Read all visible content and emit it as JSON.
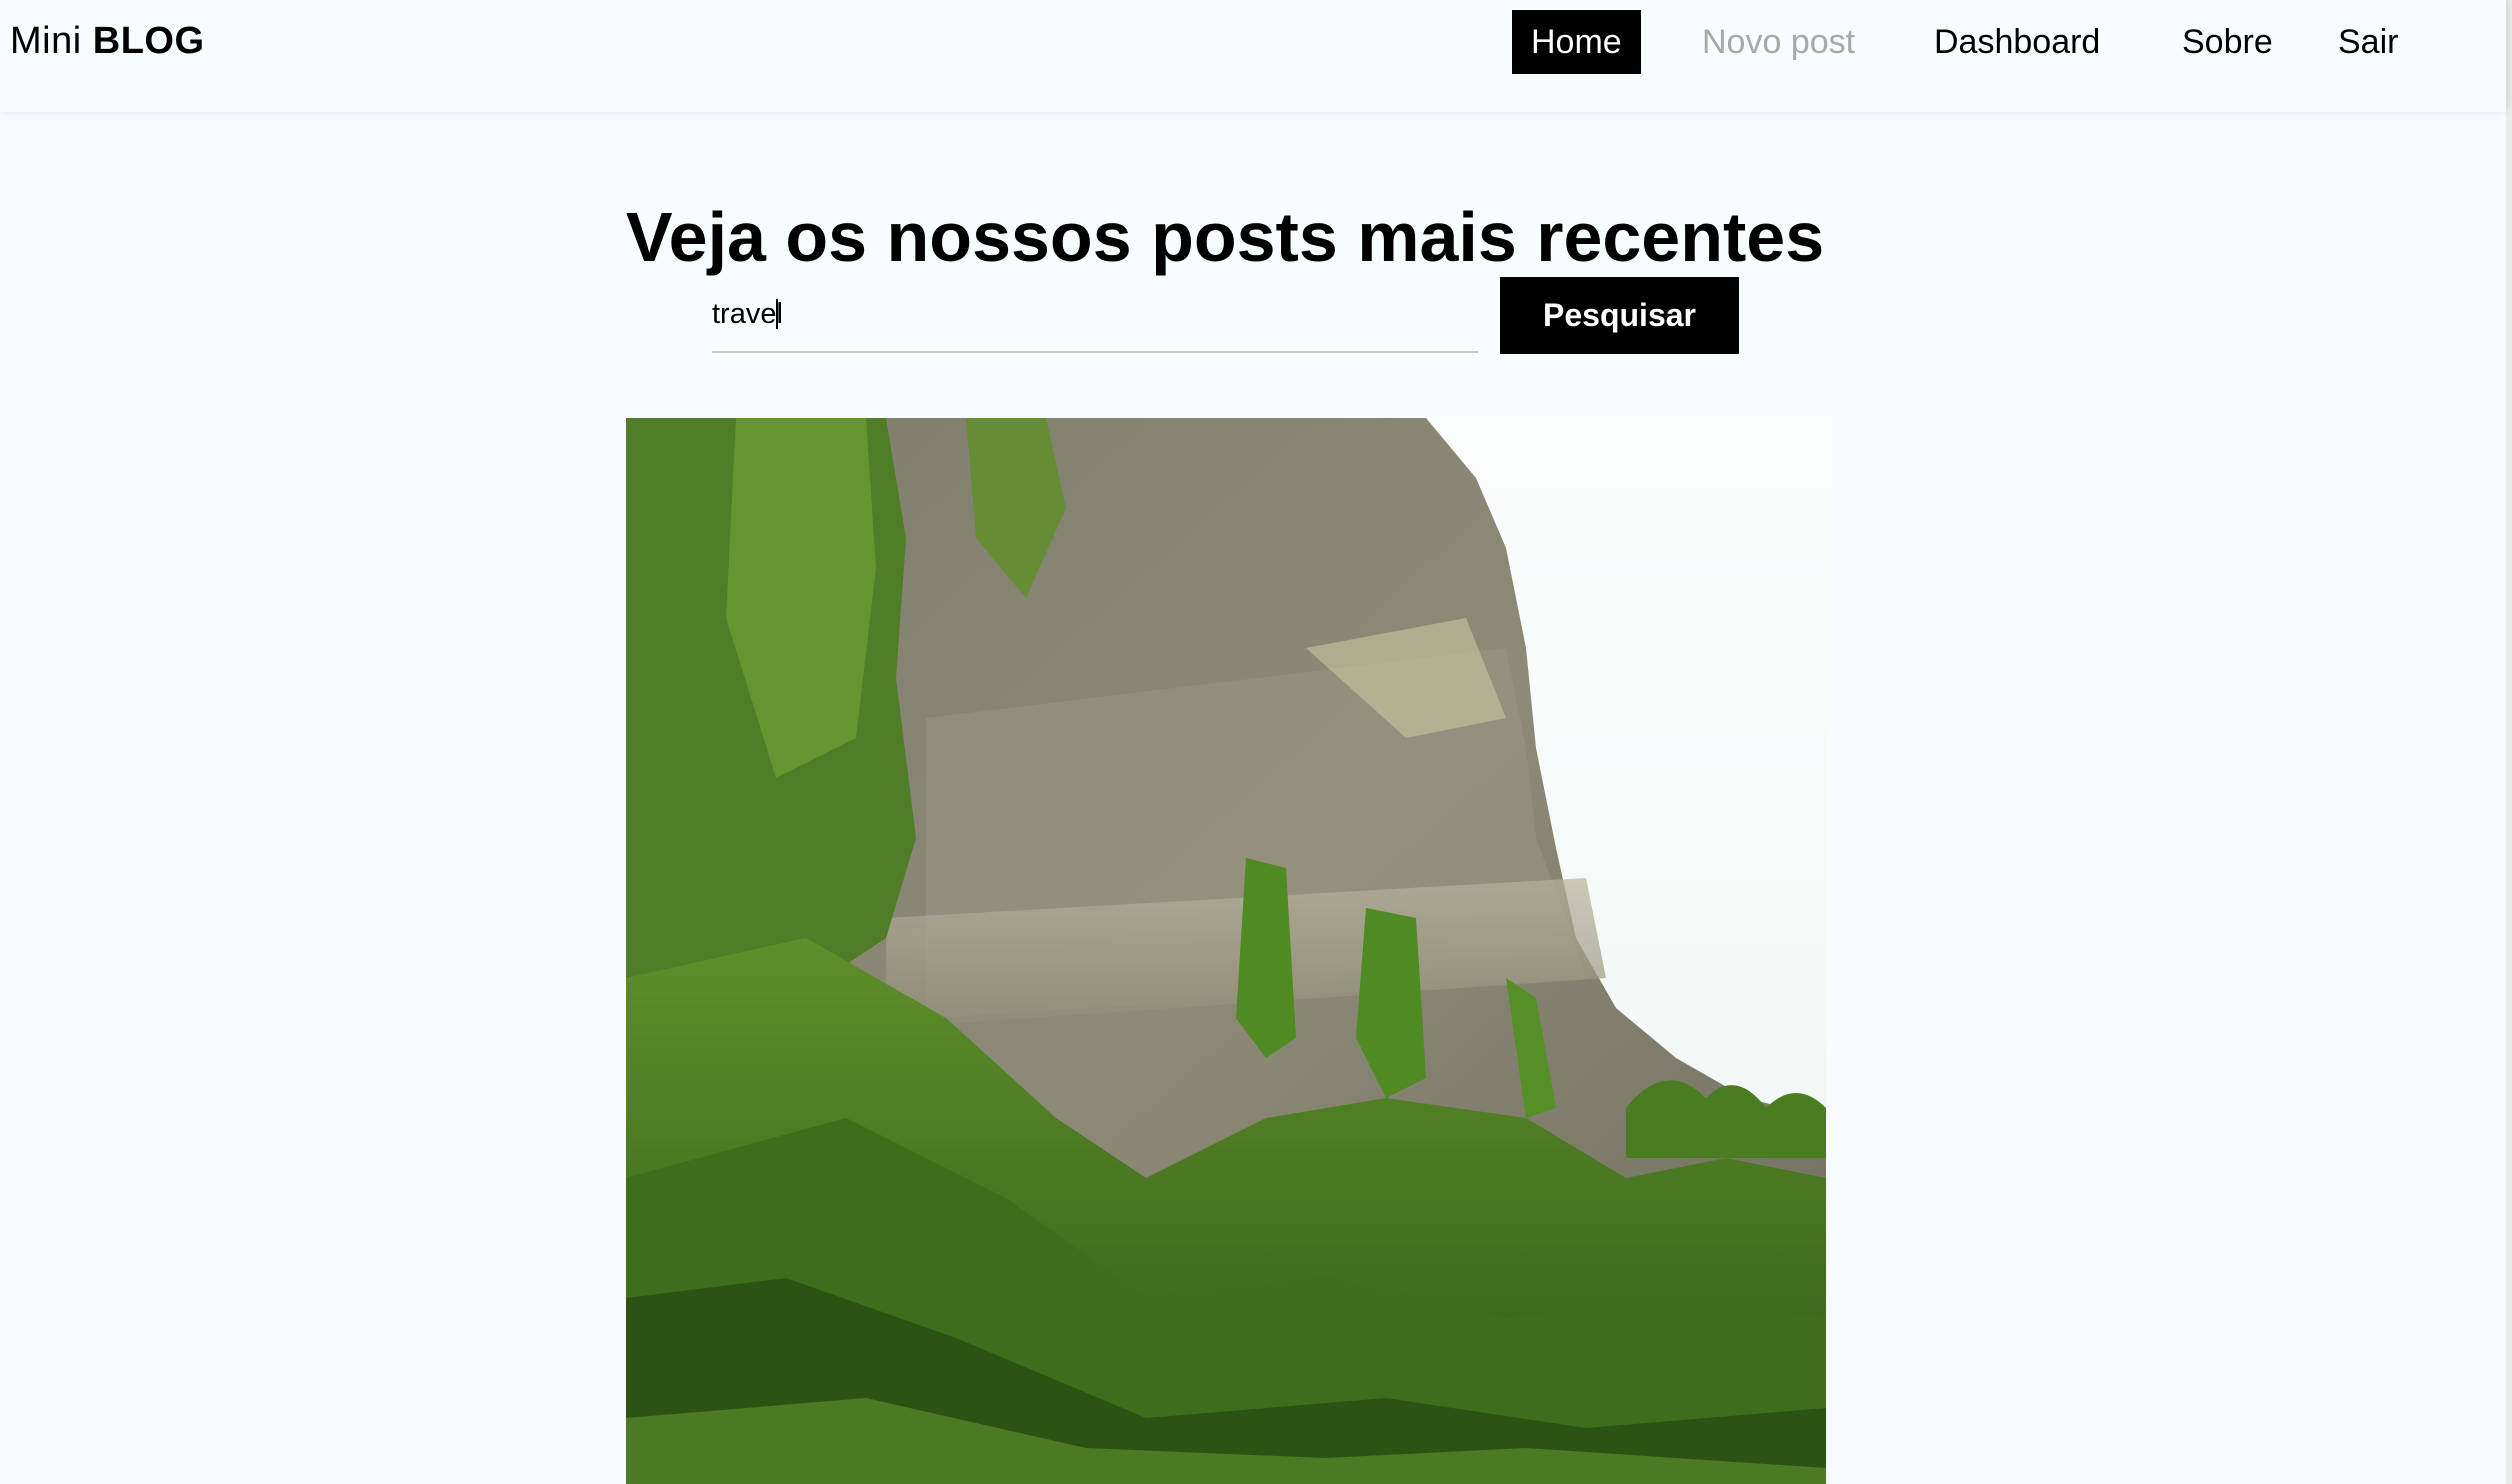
{
  "navbar": {
    "brand": {
      "prefix": "Mini",
      "strong": "BLOG"
    },
    "links": [
      {
        "label": "Home",
        "state": "active"
      },
      {
        "label": "Novo post",
        "state": "disabled"
      },
      {
        "label": "Dashboard",
        "state": "normal"
      },
      {
        "label": "Sobre",
        "state": "normal"
      },
      {
        "label": "Sair",
        "state": "normal"
      }
    ]
  },
  "main": {
    "title": "Veja os nossos posts mais recentes",
    "search": {
      "value": "travel",
      "button_label": "Pesquisar"
    },
    "post": {
      "image_subject": "mossy limestone cliff with green vegetation"
    }
  },
  "colors": {
    "background": "#f7fcff",
    "accent": "#000000",
    "disabled_link": "#a8a8a8"
  }
}
